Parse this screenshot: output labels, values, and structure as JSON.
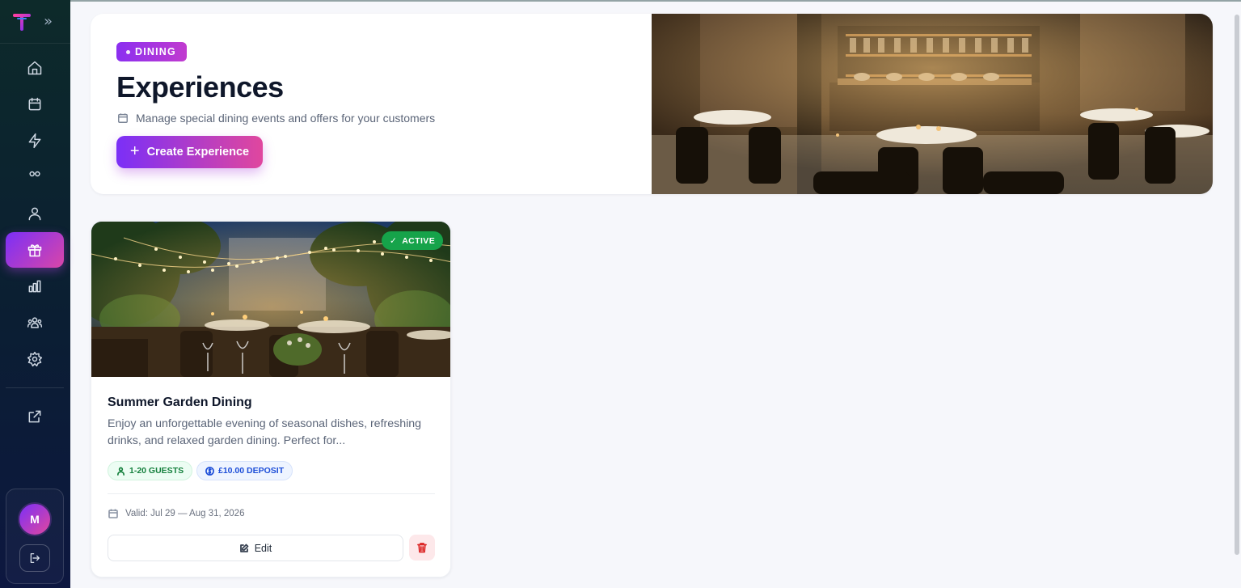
{
  "sidebar": {
    "logo_letter": "T",
    "expand_glyph": "»",
    "items": [
      {
        "name": "home-icon",
        "active": false
      },
      {
        "name": "calendar-icon",
        "active": false
      },
      {
        "name": "lightning-icon",
        "active": false
      },
      {
        "name": "tables-icon",
        "active": false
      },
      {
        "name": "user-icon",
        "active": false
      },
      {
        "name": "gift-icon",
        "active": true
      },
      {
        "name": "bar-chart-icon",
        "active": false
      },
      {
        "name": "team-icon",
        "active": false
      },
      {
        "name": "gear-icon",
        "active": false
      },
      {
        "name": "external-link-icon",
        "active": false
      }
    ],
    "avatar_initial": "M"
  },
  "hero": {
    "badge": "DINING",
    "title": "Experiences",
    "subtitle": "Manage special dining events and offers for your customers",
    "create_button": "Create Experience"
  },
  "experiences": [
    {
      "status": "ACTIVE",
      "title": "Summer Garden Dining",
      "description": "Enjoy an unforgettable evening of seasonal dishes, refreshing drinks, and relaxed garden dining. Perfect for...",
      "guests": "1-20 GUESTS",
      "deposit": "£10.00 DEPOSIT",
      "valid": "Valid: Jul 29 — Aug 31, 2026",
      "edit_label": "Edit"
    }
  ],
  "colors": {
    "accent_start": "#7b2ff7",
    "accent_end": "#e0479e",
    "active_green": "#16a34a",
    "delete_red": "#dc2626"
  }
}
